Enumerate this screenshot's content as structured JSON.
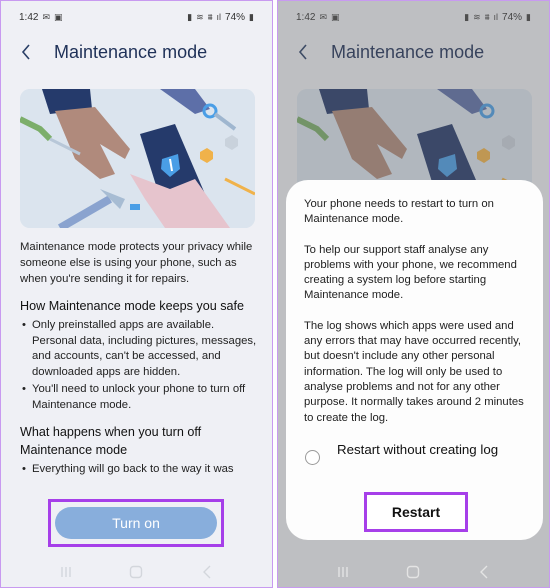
{
  "screens": {
    "left": {
      "status_bar": {
        "time": "1:42",
        "battery": "74%",
        "left_icons": [
          "gmail-icon",
          "gallery-icon"
        ],
        "right_icons": [
          "battery-saver-icon",
          "wifi-icon",
          "volte-icon",
          "signal-icon",
          "battery-icon"
        ]
      },
      "header": {
        "title": "Maintenance mode",
        "back_icon": "chevron-left-icon"
      },
      "illustration": {
        "description": "hands-exchanging-phone-with-shield-wrench-icon"
      },
      "intro": "Maintenance mode protects your privacy while someone else is using your phone, such as when you're sending it for repairs.",
      "section1": {
        "heading": "How Maintenance mode keeps you safe",
        "bullets": [
          "Only preinstalled apps are available. Personal data, including pictures, messages, and accounts, can't be accessed, and downloaded apps are hidden.",
          "You'll need to unlock your phone to turn off Maintenance mode."
        ]
      },
      "section2": {
        "heading": "What happens when you turn off Maintenance mode",
        "bullets": [
          "Everything will go back to the way it was"
        ]
      },
      "turn_on_label": "Turn on",
      "highlight_color": "#a63fe9",
      "button_color": "#88aedc"
    },
    "right": {
      "status_bar": {
        "time": "1:42",
        "battery": "74%"
      },
      "header": {
        "title": "Maintenance mode"
      },
      "dialog": {
        "paragraphs": [
          "Your phone needs to restart to turn on Maintenance mode.",
          "To help our support staff analyse any problems with your phone, we recommend creating a system log before starting Maintenance mode.",
          "The log shows which apps were used and any errors that may have occurred recently, but doesn't include any other personal information. The log will only be used to analyse problems and not for any other purpose. It normally takes around 2 minutes to create the log."
        ],
        "radio_label": "Restart without creating log",
        "radio_checked": false,
        "restart_label": "Restart"
      }
    }
  },
  "nav_bar": {
    "items": [
      "recents-icon",
      "home-icon",
      "back-icon"
    ]
  }
}
